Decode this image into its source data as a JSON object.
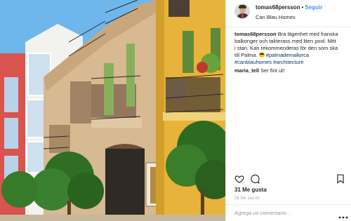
{
  "post": {
    "username": "tomas68persson",
    "separator": "•",
    "follow_label": "Seguir",
    "location": "Can Blau Homes"
  },
  "caption": {
    "author": "tomas68persson",
    "lines": [
      "Bra lägenhet med franska",
      "balkonger och takterass med liten pool. Mitt",
      "i stan. Kan rekommenderas för den som ska",
      "till Palma."
    ],
    "tags_line2": [
      "#canblauhomes",
      "#architecture"
    ],
    "tag_line1": "#palmademallorca"
  },
  "reply": {
    "author": "maria_tell",
    "text": "Ser fint ut!"
  },
  "stats": {
    "likes": "31 Me gusta",
    "date": "28 DE JULIO"
  },
  "comment_box": {
    "placeholder": "Agrega un comentario..."
  },
  "icons": {
    "like": "heart-icon",
    "comment": "comment-icon",
    "save": "bookmark-icon",
    "more": "more-dots-icon",
    "emoji": "sunglasses-emoji-icon"
  },
  "colors": {
    "link_blue": "#3897f0",
    "hashtag": "#003569",
    "facade_yellow": "#e7b33a",
    "sky": "#6fb6ec"
  }
}
